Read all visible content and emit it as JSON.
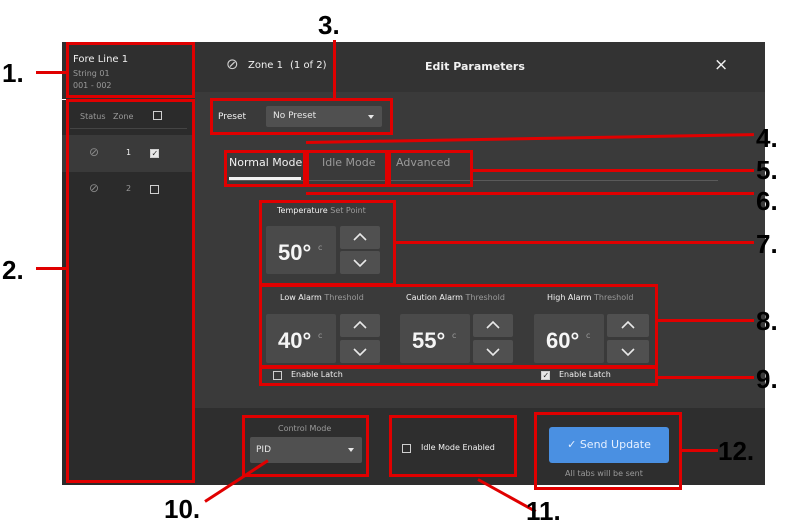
{
  "callouts": [
    "1.",
    "2.",
    "3.",
    "4.",
    "5.",
    "6.",
    "7.",
    "8.",
    "9.",
    "10.",
    "11.",
    "12."
  ],
  "sidebar": {
    "title": "Fore Line 1",
    "subtitle": "String 01",
    "range": "001 - 002",
    "columns": {
      "status": "Status",
      "zone": "Zone"
    },
    "zones": [
      {
        "number": "1",
        "checked": true
      },
      {
        "number": "2",
        "checked": false
      }
    ]
  },
  "header": {
    "zone_label": "Zone 1",
    "zone_count": "(1 of 2)",
    "title": "Edit Parameters",
    "close_glyph": "×"
  },
  "preset": {
    "label": "Preset",
    "value": "No Preset"
  },
  "tabs": [
    {
      "label": "Normal Mode",
      "active": true
    },
    {
      "label": "Idle Mode",
      "active": false
    },
    {
      "label": "Advanced",
      "active": false
    }
  ],
  "temperature": {
    "label": "Temperature",
    "label_suffix": "Set Point",
    "value": "50°",
    "unit": "c"
  },
  "alarms": [
    {
      "label": "Low Alarm",
      "suffix": "Threshold",
      "value": "40°",
      "unit": "c"
    },
    {
      "label": "Caution Alarm",
      "suffix": "Threshold",
      "value": "55°",
      "unit": "c"
    },
    {
      "label": "High Alarm",
      "suffix": "Threshold",
      "value": "60°",
      "unit": "c"
    }
  ],
  "latch": [
    {
      "label": "Enable Latch",
      "checked": false
    },
    {
      "label": "Enable Latch",
      "checked": true
    }
  ],
  "footer": {
    "control_mode_label": "Control Mode",
    "control_mode_value": "PID",
    "idle_mode_label": "Idle Mode Enabled",
    "send_label": "Send Update",
    "send_note": "All tabs will be sent"
  },
  "colors": {
    "annotation": "#e00000",
    "accent": "#4a90e2",
    "background": "#3a3a3a"
  }
}
